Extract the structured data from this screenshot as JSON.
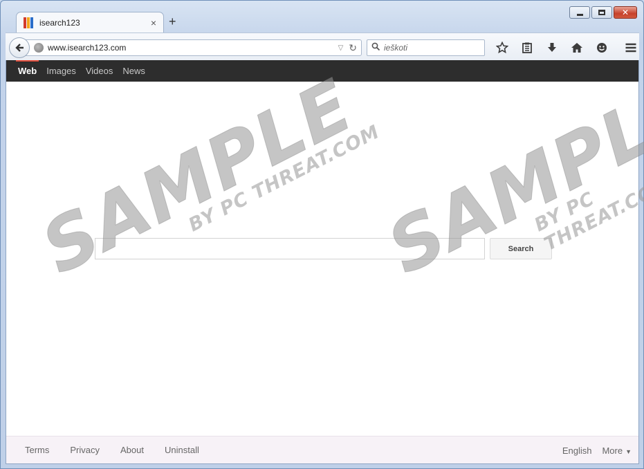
{
  "window": {
    "tab_title": "isearch123",
    "new_tab": "+",
    "close_tab": "×",
    "controls": {
      "close": "✕"
    }
  },
  "navbar": {
    "url": "www.isearch123.com",
    "search_placeholder": "ieškoti"
  },
  "site_nav": {
    "items": [
      {
        "label": "Web"
      },
      {
        "label": "Images"
      },
      {
        "label": "Videos"
      },
      {
        "label": "News"
      }
    ]
  },
  "search": {
    "button_label": "Search",
    "value": ""
  },
  "footer": {
    "links": [
      {
        "label": "Terms"
      },
      {
        "label": "Privacy"
      },
      {
        "label": "About"
      },
      {
        "label": "Uninstall"
      }
    ],
    "language": "English",
    "more": "More"
  },
  "watermark": {
    "main": "SAMPLE",
    "sub": "BY PC THREAT.COM"
  },
  "colors": {
    "nav_bg": "#2d2d2d",
    "nav_active_bar": "#dd4b39",
    "footer_bg": "#f7f2f7"
  }
}
